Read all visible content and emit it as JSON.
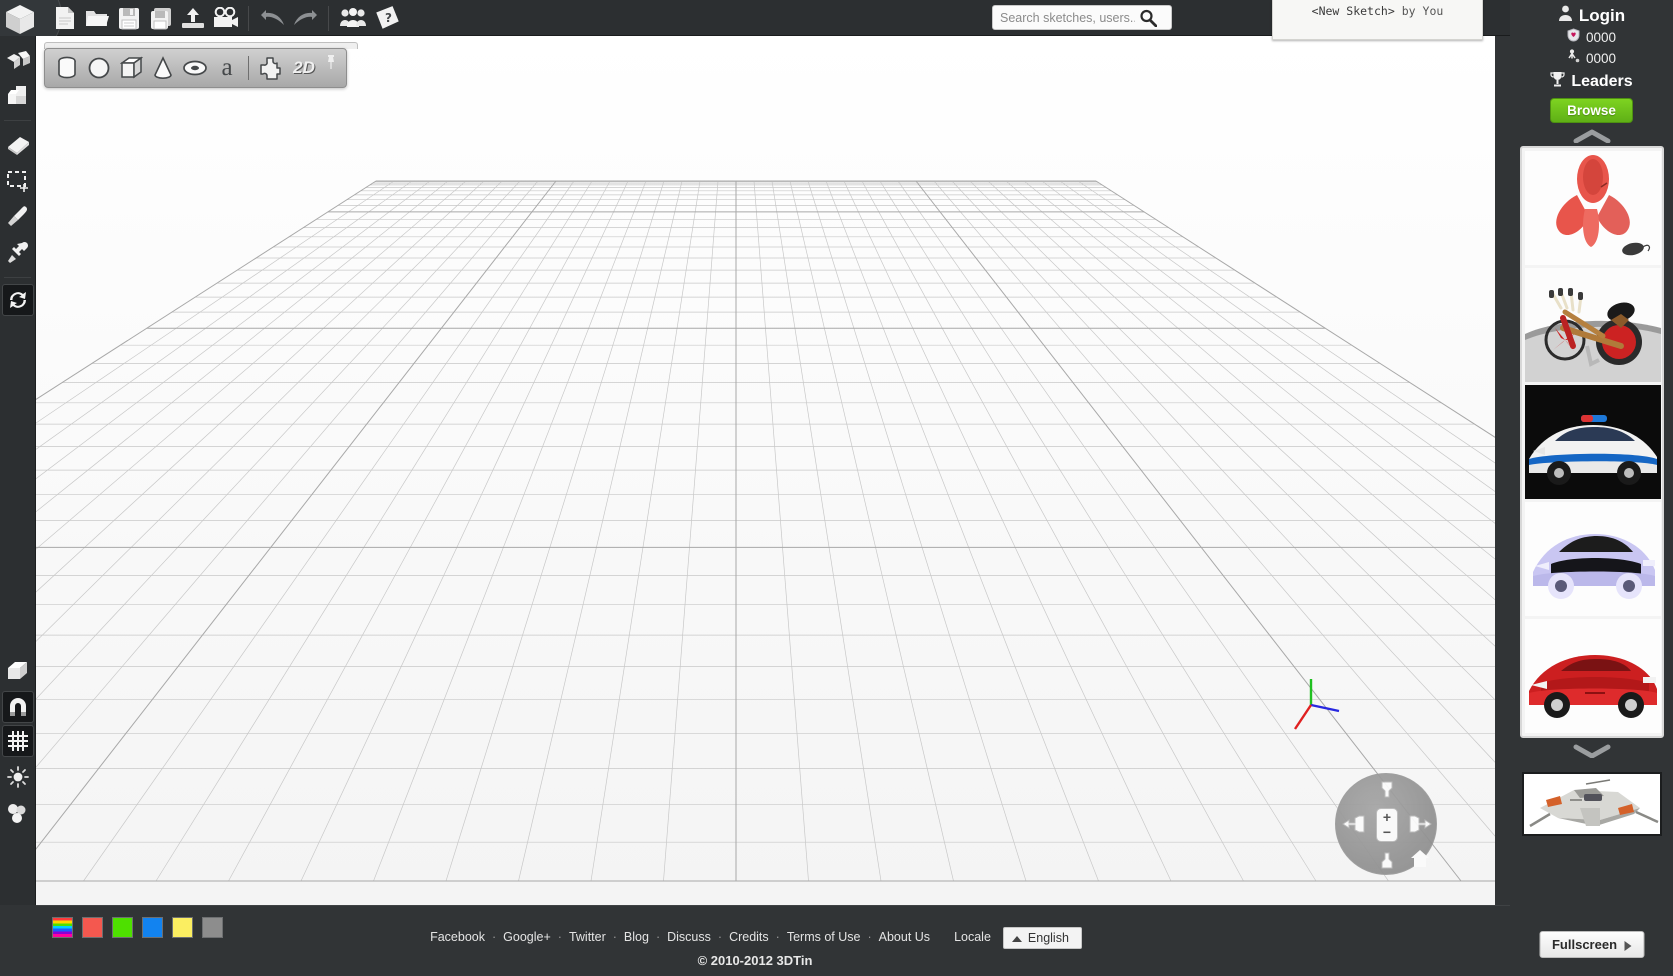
{
  "app": {
    "title": "3DTin",
    "copyright": "© 2010-2012 3DTin"
  },
  "topbar": {
    "logo_icon": "cube-logo-icon",
    "buttons": [
      {
        "name": "new-file-button",
        "icon": "new-document-icon",
        "label": "New"
      },
      {
        "name": "open-file-button",
        "icon": "open-folder-icon",
        "label": "Open"
      },
      {
        "name": "save-button",
        "icon": "floppy-save-icon",
        "label": "Save"
      },
      {
        "name": "save-as-button",
        "icon": "floppy-copy-icon",
        "label": "Save As"
      },
      {
        "name": "export-button",
        "icon": "upload-icon",
        "label": "Export"
      },
      {
        "name": "record-button",
        "icon": "movie-camera-icon",
        "label": "Record"
      },
      {
        "name": "undo-button",
        "icon": "undo-arrow-icon",
        "label": "Undo"
      },
      {
        "name": "redo-button",
        "icon": "redo-arrow-icon",
        "label": "Redo"
      },
      {
        "name": "community-button",
        "icon": "people-group-icon",
        "label": "Community"
      },
      {
        "name": "help-button",
        "icon": "help-book-icon",
        "label": "Help"
      }
    ]
  },
  "search": {
    "placeholder": "Search sketches, users...",
    "value": "",
    "icon": "magnifier-icon"
  },
  "sketch_title": {
    "name": "<New Sketch>",
    "author_prefix": "by",
    "author": "You"
  },
  "shapebar": {
    "tools": [
      {
        "name": "tool-cylinder",
        "icon": "cylinder-icon",
        "label": "Cylinder"
      },
      {
        "name": "tool-sphere",
        "icon": "sphere-icon",
        "label": "Sphere"
      },
      {
        "name": "tool-box",
        "icon": "box-icon",
        "label": "Box"
      },
      {
        "name": "tool-cone",
        "icon": "cone-icon",
        "label": "Cone"
      },
      {
        "name": "tool-torus",
        "icon": "torus-icon",
        "label": "Torus"
      },
      {
        "name": "tool-text",
        "icon": "letter-a-icon",
        "label": "a"
      },
      {
        "name": "tool-plugin",
        "icon": "puzzle-piece-icon",
        "label": "Plugin"
      },
      {
        "name": "tool-2d",
        "icon": "two-d-icon",
        "label": "2D"
      }
    ],
    "pin": {
      "name": "pin-toolbar-button",
      "icon": "pushpin-icon"
    }
  },
  "lefttool": {
    "items": [
      {
        "name": "tool-pushpull",
        "icon": "push-pull-icon",
        "label": "Push/Pull",
        "active": false
      },
      {
        "name": "tool-blocks",
        "icon": "stacked-blocks-icon",
        "label": "Blocks",
        "active": false
      },
      {
        "name": "tool-eraser",
        "icon": "eraser-icon",
        "label": "Eraser",
        "active": false
      },
      {
        "name": "tool-select",
        "icon": "marquee-select-icon",
        "label": "Select",
        "active": false
      },
      {
        "name": "tool-paint",
        "icon": "paint-brush-icon",
        "label": "Paint",
        "active": false
      },
      {
        "name": "tool-eyedropper",
        "icon": "eyedropper-icon",
        "label": "Pick Color",
        "active": false
      },
      {
        "name": "tool-rotate",
        "icon": "rotate-refresh-icon",
        "label": "Rotate",
        "active": true
      }
    ],
    "bottom_items": [
      {
        "name": "tool-shape-view",
        "icon": "shaded-box-icon",
        "label": "Shading",
        "active": false
      },
      {
        "name": "tool-snap",
        "icon": "magnet-icon",
        "label": "Snap",
        "active": true
      },
      {
        "name": "tool-grid",
        "icon": "grid-icon",
        "label": "Grid",
        "active": true
      },
      {
        "name": "tool-light",
        "icon": "sun-light-icon",
        "label": "Lighting",
        "active": false
      },
      {
        "name": "tool-material",
        "icon": "molecule-icon",
        "label": "Material",
        "active": false
      }
    ]
  },
  "palette": {
    "swatches": [
      {
        "name": "swatch-rainbow",
        "color": "rainbow"
      },
      {
        "name": "swatch-red",
        "color": "#f4584f"
      },
      {
        "name": "swatch-green",
        "color": "#4ee000"
      },
      {
        "name": "swatch-blue",
        "color": "#1283f0"
      },
      {
        "name": "swatch-yellow",
        "color": "#fbee61"
      },
      {
        "name": "swatch-gray",
        "color": "#8d8d8d"
      }
    ]
  },
  "nav_widget": {
    "axis": {
      "x_color": "#e02020",
      "y_color": "#2020e0",
      "z_color": "#20d020"
    },
    "buttons": [
      {
        "name": "nav-pan-up",
        "icon": "arrow-up-icon"
      },
      {
        "name": "nav-pan-left",
        "icon": "arrow-left-icon"
      },
      {
        "name": "nav-zoom-in",
        "icon": "plus-icon",
        "label": "+"
      },
      {
        "name": "nav-zoom-out",
        "icon": "minus-icon",
        "label": "−"
      },
      {
        "name": "nav-pan-right",
        "icon": "arrow-right-icon"
      },
      {
        "name": "nav-pan-down",
        "icon": "arrow-down-icon"
      },
      {
        "name": "nav-home",
        "icon": "home-icon"
      }
    ]
  },
  "footer": {
    "links": [
      "Facebook",
      "Google+",
      "Twitter",
      "Blog",
      "Discuss",
      "Credits",
      "Terms of Use",
      "About Us"
    ],
    "locale_label": "Locale",
    "locale_value": "English"
  },
  "sidebar": {
    "login_label": "Login",
    "login_icon": "user-silhouette-icon",
    "stats": [
      {
        "name": "stat-shield",
        "icon": "shield-heart-icon",
        "value": "0000"
      },
      {
        "name": "stat-user",
        "icon": "person-pin-icon",
        "value": "0000"
      }
    ],
    "leaders_label": "Leaders",
    "leaders_icon": "trophy-icon",
    "browse_label": "Browse",
    "scroll_up_icon": "chevron-up-icon",
    "scroll_down_icon": "chevron-down-icon",
    "thumbnails": [
      {
        "name": "thumb-red-figure",
        "alt": "Red abstract figure sketch"
      },
      {
        "name": "thumb-chopper-bike",
        "alt": "Red chopper bicycle sketch"
      },
      {
        "name": "thumb-police-car",
        "alt": "White and blue police sports car sketch"
      },
      {
        "name": "thumb-lavender-car",
        "alt": "Lavender concept car sketch"
      },
      {
        "name": "thumb-red-sportscar",
        "alt": "Red sports car sketch"
      }
    ],
    "featured": {
      "name": "featured-snowspeeder",
      "alt": "Grey and orange snowspeeder sketch"
    },
    "fullscreen_label": "Fullscreen"
  }
}
